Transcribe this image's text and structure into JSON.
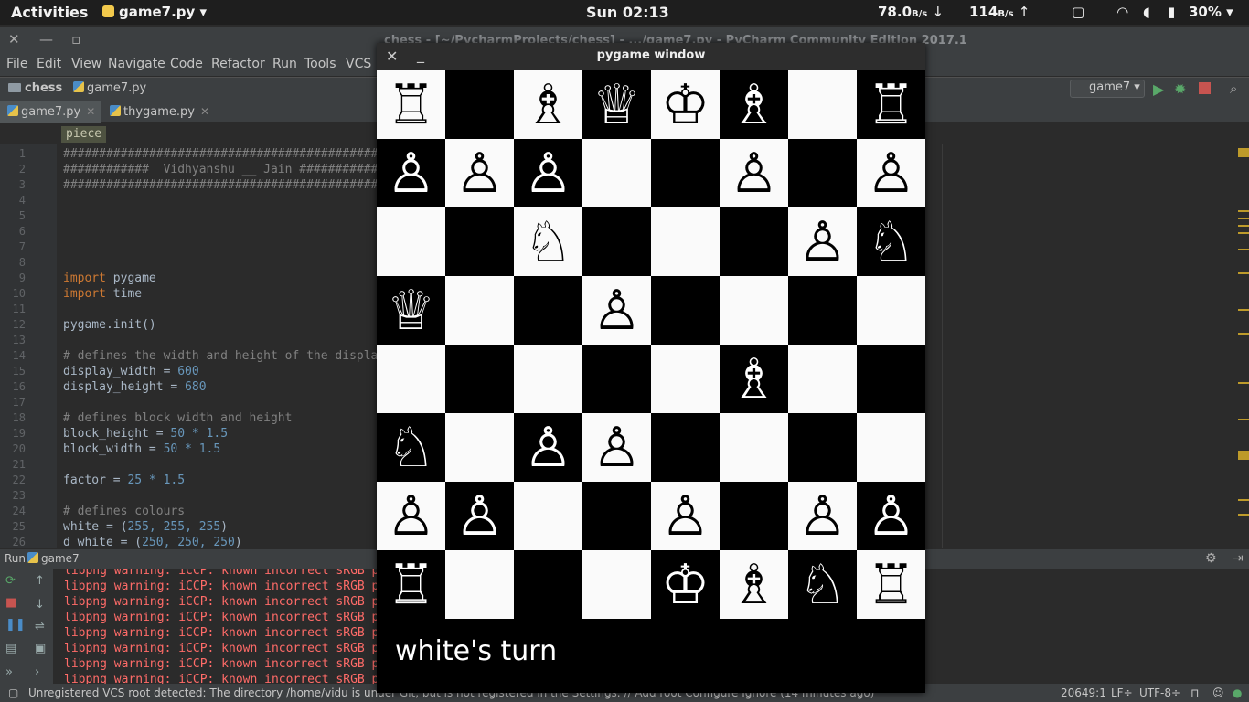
{
  "topbar": {
    "activities": "Activities",
    "app": "game7.py ▾",
    "clock": "Sun 02:13",
    "net_down": "78.0",
    "net_down_unit": "B/s",
    "net_up": "114",
    "net_up_unit": "B/s",
    "battery": "30% ▾"
  },
  "pycharm": {
    "title": "chess - [~/PycharmProjects/chess] - .../game7.py - PyCharm Community Edition 2017.1",
    "menu": [
      "File",
      "Edit",
      "View",
      "Navigate",
      "Code",
      "Refactor",
      "Run",
      "Tools",
      "VCS"
    ],
    "breadcrumbs": [
      "chess",
      "game7.py"
    ],
    "run_config": "game7",
    "tabs": [
      "game7.py",
      "thygame.py"
    ],
    "crumb_piece": "piece",
    "lines": [
      {
        "n": "1",
        "text": "######################################################"
      },
      {
        "n": "2",
        "text": "############  Vidhyanshu __ Jain ######################"
      },
      {
        "n": "3",
        "text": "######################################################"
      },
      {
        "n": "4",
        "text": ""
      },
      {
        "n": "5",
        "text": ""
      },
      {
        "n": "6",
        "text": ""
      },
      {
        "n": "7",
        "text": ""
      },
      {
        "n": "8",
        "text": ""
      },
      {
        "n": "9",
        "kw": "import",
        "text": " pygame"
      },
      {
        "n": "10",
        "kw": "import",
        "text": " time"
      },
      {
        "n": "11",
        "text": ""
      },
      {
        "n": "12",
        "text": "pygame.init()"
      },
      {
        "n": "13",
        "text": ""
      },
      {
        "n": "14",
        "com": "# defines the width and height of the display"
      },
      {
        "n": "15",
        "text": "display_width = ",
        "num": "600"
      },
      {
        "n": "16",
        "text": "display_height = ",
        "num": "680"
      },
      {
        "n": "17",
        "text": ""
      },
      {
        "n": "18",
        "com": "# defines block width and height"
      },
      {
        "n": "19",
        "text": "block_height = ",
        "num": "50 * 1.5"
      },
      {
        "n": "20",
        "text": "block_width = ",
        "num": "50 * 1.5"
      },
      {
        "n": "21",
        "text": ""
      },
      {
        "n": "22",
        "text": "factor = ",
        "num": "25 * 1.5"
      },
      {
        "n": "23",
        "text": ""
      },
      {
        "n": "24",
        "com": "# defines colours"
      },
      {
        "n": "25",
        "text": "white = (",
        "num": "255, 255, 255",
        "tail": ")"
      },
      {
        "n": "26",
        "text": "d_white = (",
        "num": "250, 250, 250",
        "tail": ")"
      }
    ],
    "run_label": "Run",
    "run_target": "game7",
    "warnings": [
      "libpng warning: iCCP: known incorrect sRGB profile",
      "libpng warning: iCCP: known incorrect sRGB profile",
      "libpng warning: iCCP: known incorrect sRGB profile",
      "libpng warning: iCCP: known incorrect sRGB profile",
      "libpng warning: iCCP: known incorrect sRGB profile",
      "libpng warning: iCCP: known incorrect sRGB profile",
      "libpng warning: iCCP: known incorrect sRGB profile",
      "libpng warning: iCCP: known incorrect sRGB profile"
    ],
    "status_msg": "Unregistered VCS root detected: The directory /home/vidu is under Git, but is not registered in the Settings. // Add root  Configure  Ignore (14 minutes ago)",
    "status_pos": "20649:1",
    "status_lf": "LF÷",
    "status_enc": "UTF-8÷"
  },
  "pygame": {
    "title": "pygame window",
    "turn_text": "white's turn",
    "board": [
      [
        "R",
        "",
        "B",
        "Q",
        "K",
        "B",
        "",
        "R"
      ],
      [
        "P",
        "P",
        "P",
        "",
        "",
        "P",
        "",
        "P"
      ],
      [
        "",
        "",
        "N",
        "",
        "",
        "",
        "P",
        "N"
      ],
      [
        "Q",
        "",
        "",
        "P",
        "",
        "",
        "",
        ""
      ],
      [
        "",
        "",
        "",
        "",
        "",
        "B",
        "",
        ""
      ],
      [
        "N",
        "",
        "P",
        "P",
        "",
        "",
        "",
        ""
      ],
      [
        "P",
        "P",
        "",
        "",
        "P",
        "",
        "P",
        "P"
      ],
      [
        "R",
        "",
        "",
        "",
        "K",
        "B",
        "N",
        "R"
      ]
    ],
    "pieces": {
      "K": "♔",
      "Q": "♕",
      "R": "♖",
      "B": "♗",
      "N": "♘",
      "P": "♙"
    }
  }
}
